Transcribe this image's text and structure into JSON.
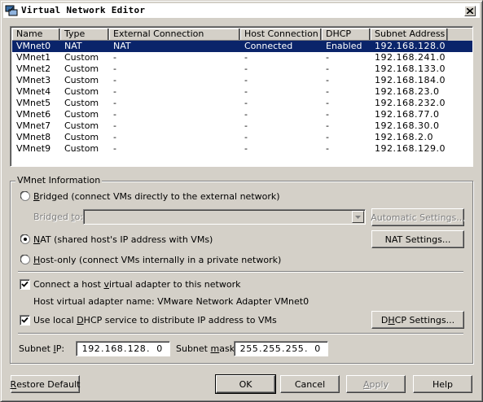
{
  "window": {
    "title": "Virtual Network Editor"
  },
  "table": {
    "columns": [
      "Name",
      "Type",
      "External Connection",
      "Host Connection",
      "DHCP",
      "Subnet Address"
    ],
    "rows": [
      {
        "name": "VMnet0",
        "type": "NAT",
        "external": "NAT",
        "host": "Connected",
        "dhcp": "Enabled",
        "subnet": "192.168.128.0",
        "selected": true
      },
      {
        "name": "VMnet1",
        "type": "Custom",
        "external": "-",
        "host": "-",
        "dhcp": "-",
        "subnet": "192.168.241.0"
      },
      {
        "name": "VMnet2",
        "type": "Custom",
        "external": "-",
        "host": "-",
        "dhcp": "-",
        "subnet": "192.168.133.0"
      },
      {
        "name": "VMnet3",
        "type": "Custom",
        "external": "-",
        "host": "-",
        "dhcp": "-",
        "subnet": "192.168.184.0"
      },
      {
        "name": "VMnet4",
        "type": "Custom",
        "external": "-",
        "host": "-",
        "dhcp": "-",
        "subnet": "192.168.23.0"
      },
      {
        "name": "VMnet5",
        "type": "Custom",
        "external": "-",
        "host": "-",
        "dhcp": "-",
        "subnet": "192.168.232.0"
      },
      {
        "name": "VMnet6",
        "type": "Custom",
        "external": "-",
        "host": "-",
        "dhcp": "-",
        "subnet": "192.168.77.0"
      },
      {
        "name": "VMnet7",
        "type": "Custom",
        "external": "-",
        "host": "-",
        "dhcp": "-",
        "subnet": "192.168.30.0"
      },
      {
        "name": "VMnet8",
        "type": "Custom",
        "external": "-",
        "host": "-",
        "dhcp": "-",
        "subnet": "192.168.2.0"
      },
      {
        "name": "VMnet9",
        "type": "Custom",
        "external": "-",
        "host": "-",
        "dhcp": "-",
        "subnet": "192.168.129.0"
      }
    ]
  },
  "vmnet_info": {
    "group_label": "VMnet Information",
    "bridged": {
      "label_pre": "",
      "label_key": "B",
      "label_post": "ridged (connect VMs directly to the external network)",
      "checked": false
    },
    "bridged_to": {
      "label_pre": "Bridged ",
      "label_key": "t",
      "label_post": "o:",
      "value": ""
    },
    "automatic_settings_label": "Automatic Settings...",
    "nat": {
      "label_pre": "",
      "label_key": "N",
      "label_post": "AT (shared host's IP address with VMs)",
      "checked": true
    },
    "nat_settings_label": "NAT Settings...",
    "hostonly": {
      "label_pre": "",
      "label_key": "H",
      "label_post": "ost-only (connect VMs internally in a private network)",
      "checked": false
    },
    "connect_adapter": {
      "label_pre": "Connect a host ",
      "label_key": "v",
      "label_post": "irtual adapter to this network",
      "checked": true
    },
    "adapter_name_label": "Host virtual adapter name: VMware Network Adapter VMnet0",
    "use_dhcp": {
      "label_pre": "Use local ",
      "label_key": "D",
      "label_post": "HCP service to distribute IP address to VMs",
      "checked": true
    },
    "dhcp_settings": {
      "pre": "D",
      "key": "H",
      "post": "CP Settings..."
    },
    "subnet_ip": {
      "label_pre": "Subnet ",
      "label_key": "I",
      "label_post": "P:",
      "octets": [
        "192",
        "168",
        "128",
        "0"
      ]
    },
    "subnet_mask": {
      "label_pre": "Subnet ",
      "label_key": "m",
      "label_post": "ask:",
      "octets": [
        "255",
        "255",
        "255",
        "0"
      ]
    }
  },
  "buttons": {
    "restore_default": {
      "pre": "",
      "key": "R",
      "post": "estore Default"
    },
    "ok": "OK",
    "cancel": "Cancel",
    "apply": {
      "pre": "",
      "key": "A",
      "post": "pply"
    },
    "help": "Help"
  },
  "colors": {
    "selection": "#0a246a",
    "face": "#d4d0c8"
  }
}
